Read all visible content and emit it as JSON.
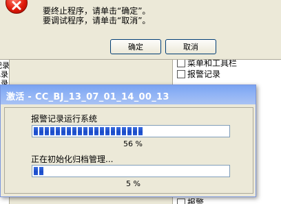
{
  "error_dialog": {
    "message_line_1": "要终止程序，请单击“确定”。",
    "message_line_2": "要调试程序，请单击“取消”。",
    "ok_label": "确定",
    "cancel_label": "取消"
  },
  "background_app": {
    "left_items": [
      "記录",
      "己录",
      "己录"
    ],
    "right_items": [
      "菜单和工具栏",
      "报警记录",
      "报警"
    ]
  },
  "activation_window": {
    "title": "激活 - CC_BJ_13_07_01_14_00_13",
    "task_1": {
      "label": "报警记录运行系统",
      "percent_text": "56 %",
      "progress": 0.56
    },
    "task_2": {
      "label": "正在初始化归档管理...",
      "percent_text": "5 %",
      "progress": 0.05
    }
  },
  "colors": {
    "title_bar": "#8db1f5",
    "progress_fill": "#1a4bc7",
    "error_icon": "#e01a0a"
  }
}
